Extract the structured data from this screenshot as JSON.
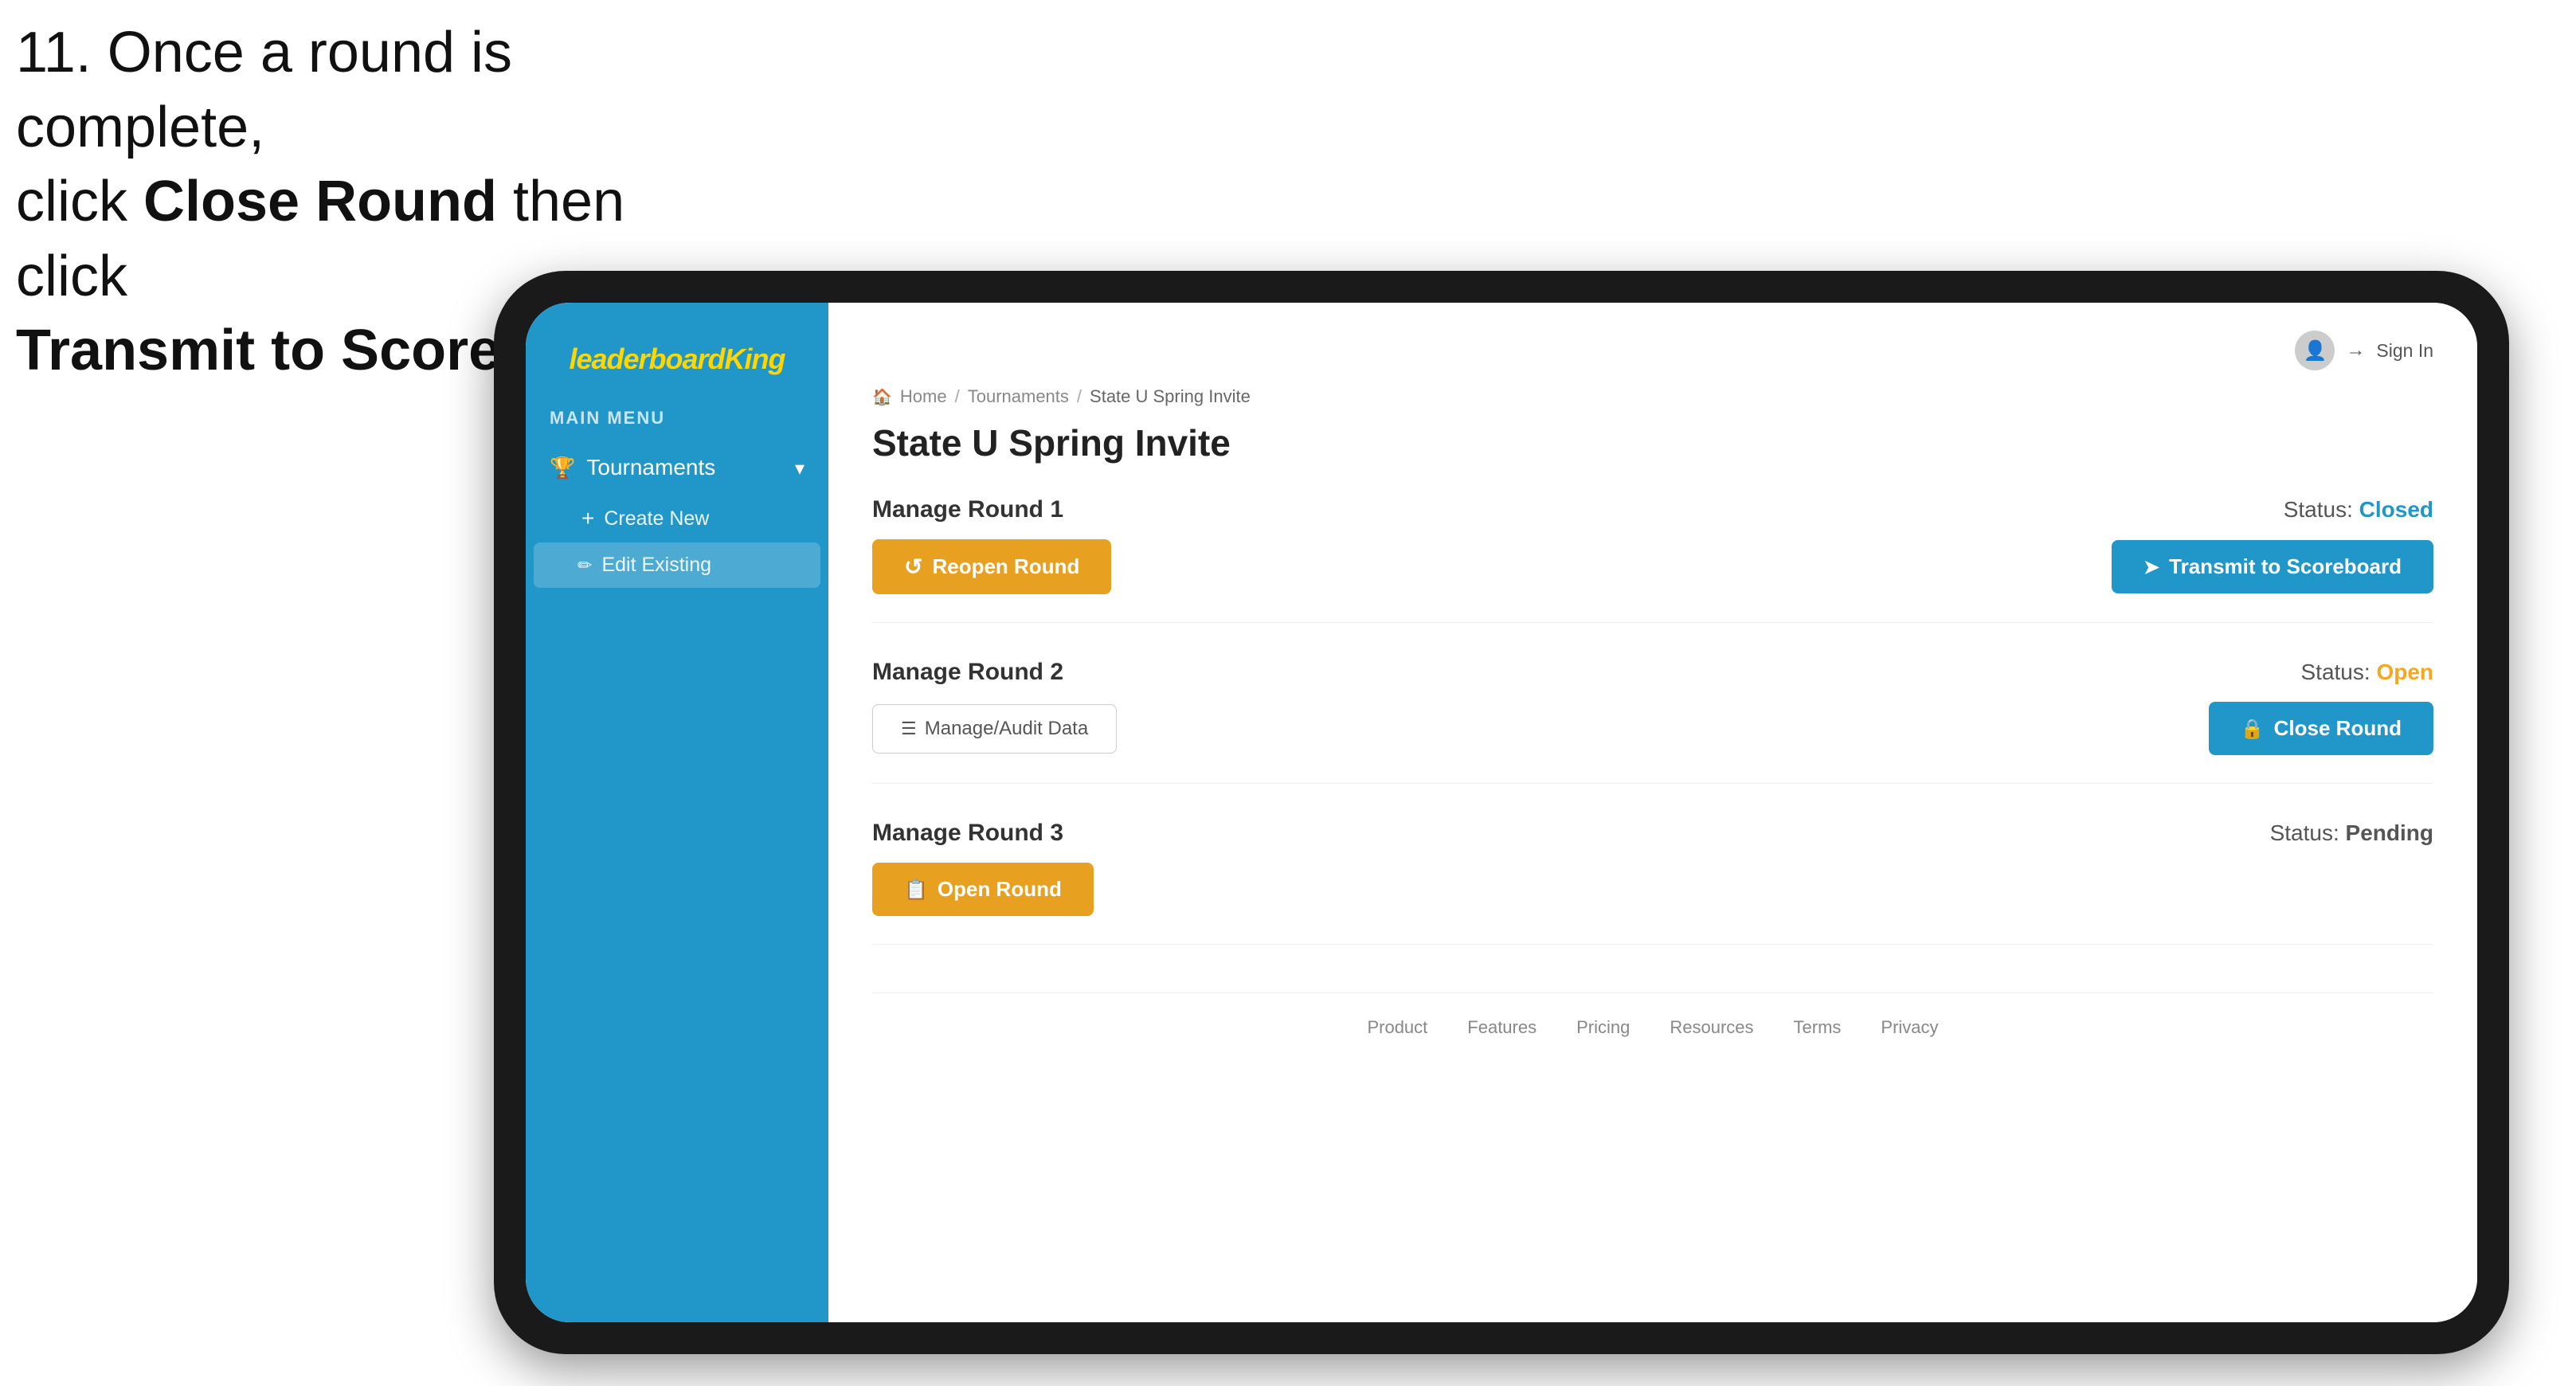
{
  "instruction": {
    "line1": "11. Once a round is complete,",
    "line2_pre": "click ",
    "line2_bold": "Close Round",
    "line2_post": " then click",
    "line3": "Transmit to Scoreboard."
  },
  "sidebar": {
    "logo_plain": "leaderboard",
    "logo_styled": "King",
    "menu_label": "MAIN MENU",
    "tournaments_label": "Tournaments",
    "create_new_label": "Create New",
    "edit_existing_label": "Edit Existing"
  },
  "topbar": {
    "sign_in_label": "Sign In"
  },
  "breadcrumb": {
    "home": "Home",
    "tournaments": "Tournaments",
    "current": "State U Spring Invite"
  },
  "page": {
    "title": "State U Spring Invite"
  },
  "rounds": [
    {
      "label": "Manage Round 1",
      "status_label": "Status:",
      "status_value": "Closed",
      "status_type": "closed",
      "left_button": "Reopen Round",
      "right_button": "Transmit to Scoreboard",
      "has_manage": false
    },
    {
      "label": "Manage Round 2",
      "status_label": "Status:",
      "status_value": "Open",
      "status_type": "open",
      "left_button": "Manage/Audit Data",
      "right_button": "Close Round",
      "has_manage": true
    },
    {
      "label": "Manage Round 3",
      "status_label": "Status:",
      "status_value": "Pending",
      "status_type": "pending",
      "left_button": "Open Round",
      "right_button": null,
      "has_manage": false
    }
  ],
  "footer": {
    "links": [
      "Product",
      "Features",
      "Pricing",
      "Resources",
      "Terms",
      "Privacy"
    ]
  },
  "colors": {
    "blue": "#2196c9",
    "orange": "#e8a020",
    "closed": "#2196c9",
    "open": "#f5a623",
    "pending": "#555555"
  }
}
